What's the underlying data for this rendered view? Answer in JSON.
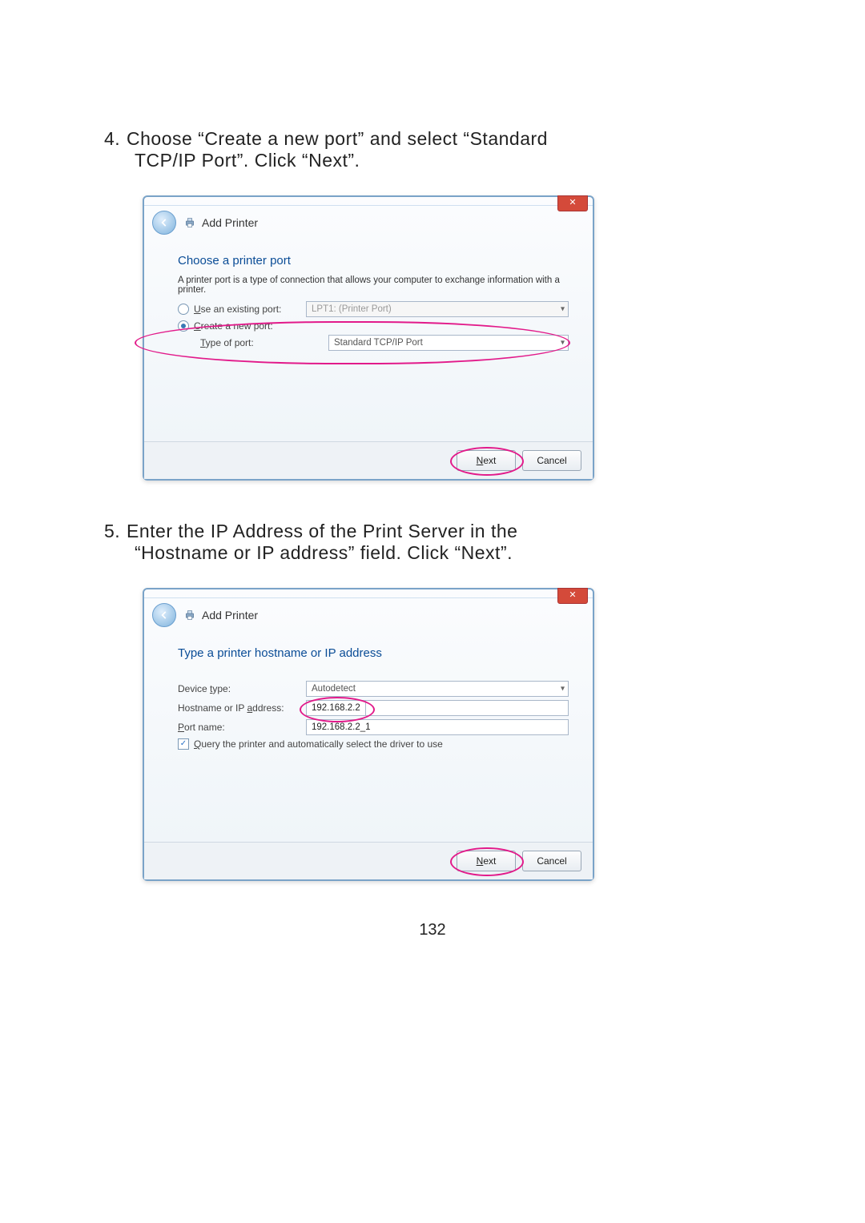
{
  "steps": {
    "s4": {
      "num": "4.",
      "line1": "Choose “Create a new port” and select “Standard",
      "line2": "TCP/IP Port”. Click “Next”."
    },
    "s5": {
      "num": "5.",
      "line1": "Enter the IP Address of the Print Server in the",
      "line2": "“Hostname or IP address” field. Click “Next”."
    }
  },
  "dialog1": {
    "title": "Add Printer",
    "heading": "Choose a printer port",
    "description": "A printer port is a type of connection that allows your computer to exchange information with a printer.",
    "opt_existing_pre": "U",
    "opt_existing_post": "se an existing port:",
    "opt_existing_value": "LPT1: (Printer Port)",
    "opt_create_pre": "C",
    "opt_create_post": "reate a new port:",
    "type_label_pre": "T",
    "type_label_post": "ype of port:",
    "type_value": "Standard TCP/IP Port",
    "next_pre": "N",
    "next_post": "ext",
    "cancel": "Cancel"
  },
  "dialog2": {
    "title": "Add Printer",
    "heading": "Type a printer hostname or IP address",
    "device_label_pre": "Device ",
    "device_label_u": "t",
    "device_label_post": "ype:",
    "device_value": "Autodetect",
    "host_label_pre": "Hostname or IP ",
    "host_label_u": "a",
    "host_label_post": "ddress:",
    "host_value": "192.168.2.2",
    "port_label_pre": "P",
    "port_label_post": "ort name:",
    "port_value": "192.168.2.2_1",
    "query_pre": "Q",
    "query_post": "uery the printer and automatically select the driver to use",
    "next_pre": "N",
    "next_post": "ext",
    "cancel": "Cancel"
  },
  "page_number": "132"
}
